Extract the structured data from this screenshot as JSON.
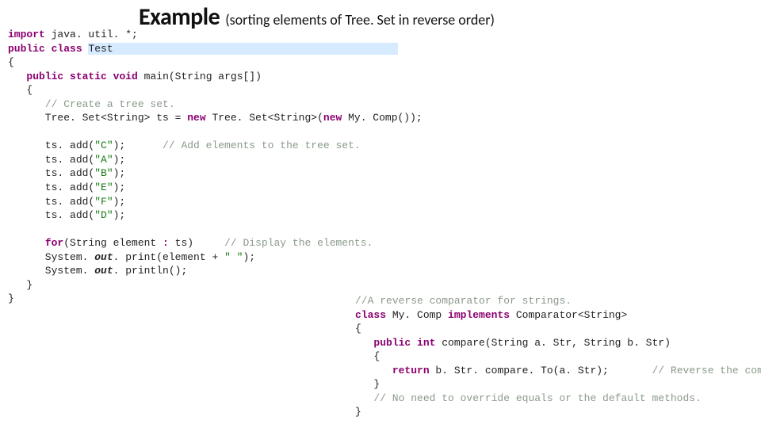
{
  "title": {
    "main": "Example",
    "sub": "(sorting elements of Tree. Set in reverse order)"
  },
  "main": {
    "l0a": "import",
    "l0b": " java. util. *;",
    "l1a": "public",
    "l1b": "class",
    "l1c": "Test",
    "l2": "{",
    "l3a": "public",
    "l3b": "static",
    "l3c": "void",
    "l3d": " main(String args[])",
    "l4": "   {",
    "l5": "// Create a tree set.",
    "l6a": "      Tree. Set<String> ts = ",
    "l6b": "new",
    "l6c": " Tree. Set<String>(",
    "l6d": "new",
    "l6e": " My. Comp());",
    "l7a": "      ts. add(",
    "l7s": "\"C\"",
    "l7b": ");      ",
    "l7c": "// Add elements to the tree set.",
    "l8a": "      ts. add(",
    "l8s": "\"A\"",
    "l8b": ");",
    "l9a": "      ts. add(",
    "l9s": "\"B\"",
    "l9b": ");",
    "l10a": "      ts. add(",
    "l10s": "\"E\"",
    "l10b": ");",
    "l11a": "      ts. add(",
    "l11s": "\"F\"",
    "l11b": ");",
    "l12a": "      ts. add(",
    "l12s": "\"D\"",
    "l12b": ");",
    "l13a": "for",
    "l13b": "(String element ",
    "l13c": ":",
    "l13d": " ts)     ",
    "l13e": "// Display the elements.",
    "l14a": "      System. ",
    "l14b": "out",
    "l14c": ". print(element + ",
    "l14d": "\" \"",
    "l14e": ");",
    "l15a": "      System. ",
    "l15b": "out",
    "l15c": ". println();",
    "l16": "   }",
    "l17": "}"
  },
  "side": {
    "c0": "//A reverse comparator for strings.",
    "l1a": "class",
    "l1b": " My. Comp ",
    "l1c": "implements",
    "l1d": " Comparator<String>",
    "l2": "{",
    "l3a": "public",
    "l3b": "int",
    "l3c": " compare(String a. Str, String b. Str)",
    "l4": "   {",
    "l5a": "return",
    "l5b": " b. Str. compare. To(a. Str);       ",
    "l5c": "// Reverse the comparison.",
    "l6": "   }",
    "l7": "// No need to override equals or the default methods.",
    "l8": "}"
  }
}
